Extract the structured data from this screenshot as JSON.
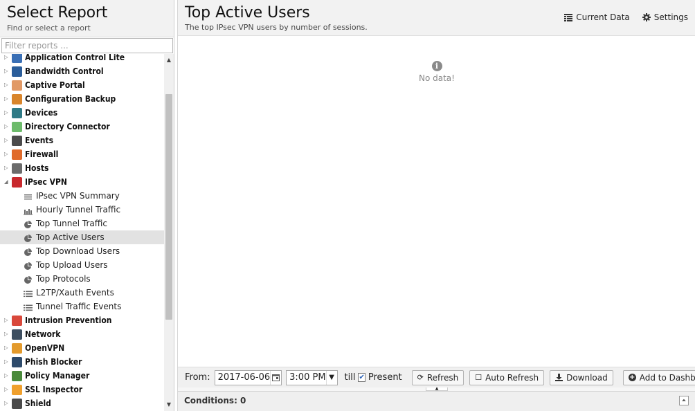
{
  "left": {
    "title": "Select Report",
    "subtitle": "Find or select a report",
    "filter_placeholder": "Filter reports ..."
  },
  "tree": [
    {
      "label": "Application Control Lite",
      "type": "category",
      "icon": "app-control-lite-icon",
      "color": "#3a6fb5"
    },
    {
      "label": "Bandwidth Control",
      "type": "category",
      "icon": "bandwidth-icon",
      "color": "#2a5d9a"
    },
    {
      "label": "Captive Portal",
      "type": "category",
      "icon": "captive-portal-icon",
      "color": "#e19966"
    },
    {
      "label": "Configuration Backup",
      "type": "category",
      "icon": "config-backup-icon",
      "color": "#d9852b"
    },
    {
      "label": "Devices",
      "type": "category",
      "icon": "devices-icon",
      "color": "#2f7a86"
    },
    {
      "label": "Directory Connector",
      "type": "category",
      "icon": "directory-icon",
      "color": "#6dbb6b"
    },
    {
      "label": "Events",
      "type": "category",
      "icon": "events-icon",
      "color": "#4b4b4b"
    },
    {
      "label": "Firewall",
      "type": "category",
      "icon": "firewall-icon",
      "color": "#e06a2a"
    },
    {
      "label": "Hosts",
      "type": "category",
      "icon": "hosts-icon",
      "color": "#6b6b6b"
    },
    {
      "label": "IPsec VPN",
      "type": "category",
      "icon": "ipsec-vpn-icon",
      "color": "#c8282d",
      "expanded": true
    },
    {
      "label": "IPsec VPN Summary",
      "type": "report",
      "icon": "text-report-icon"
    },
    {
      "label": "Hourly Tunnel Traffic",
      "type": "report",
      "icon": "bar-chart-icon"
    },
    {
      "label": "Top Tunnel Traffic",
      "type": "report",
      "icon": "pie-chart-icon"
    },
    {
      "label": "Top Active Users",
      "type": "report",
      "icon": "pie-chart-icon",
      "selected": true
    },
    {
      "label": "Top Download Users",
      "type": "report",
      "icon": "pie-chart-icon"
    },
    {
      "label": "Top Upload Users",
      "type": "report",
      "icon": "pie-chart-icon"
    },
    {
      "label": "Top Protocols",
      "type": "report",
      "icon": "pie-chart-icon"
    },
    {
      "label": "L2TP/Xauth Events",
      "type": "report",
      "icon": "list-icon"
    },
    {
      "label": "Tunnel Traffic Events",
      "type": "report",
      "icon": "list-icon"
    },
    {
      "label": "Intrusion Prevention",
      "type": "category",
      "icon": "intrusion-icon",
      "color": "#d9483b"
    },
    {
      "label": "Network",
      "type": "category",
      "icon": "network-icon",
      "color": "#3d4e60"
    },
    {
      "label": "OpenVPN",
      "type": "category",
      "icon": "openvpn-icon",
      "color": "#e39a2c"
    },
    {
      "label": "Phish Blocker",
      "type": "category",
      "icon": "phish-blocker-icon",
      "color": "#2d4a6b"
    },
    {
      "label": "Policy Manager",
      "type": "category",
      "icon": "policy-manager-icon",
      "color": "#4a8a3b"
    },
    {
      "label": "SSL Inspector",
      "type": "category",
      "icon": "ssl-inspector-icon",
      "color": "#f0a02d"
    },
    {
      "label": "Shield",
      "type": "category",
      "icon": "shield-icon",
      "color": "#4a4a4a"
    }
  ],
  "main": {
    "title": "Top Active Users",
    "subtitle": "The top IPsec VPN users by number of sessions.",
    "current_data_label": "Current Data",
    "settings_label": "Settings",
    "no_data": "No data!"
  },
  "toolbar": {
    "from_label": "From:",
    "date_value": "2017-06-06",
    "time_value": "3:00 PM",
    "till_label": "till",
    "present_label": "Present",
    "present_checked": true,
    "refresh_label": "Refresh",
    "auto_refresh_label": "Auto Refresh",
    "download_label": "Download",
    "add_dashboard_label": "Add to Dashboard"
  },
  "conditions": {
    "label": "Conditions: 0"
  }
}
